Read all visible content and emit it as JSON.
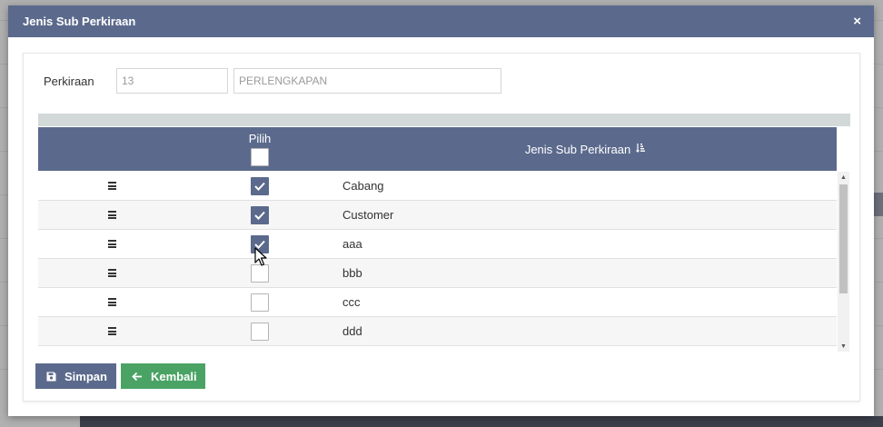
{
  "modal": {
    "title": "Jenis Sub Perkiraan",
    "close_glyph": "×"
  },
  "form": {
    "label": "Perkiraan",
    "code_placeholder": "13",
    "name_placeholder": "PERLENGKAPAN"
  },
  "grid": {
    "headers": {
      "pilih": "Pilih",
      "jenis": "Jenis Sub Perkiraan"
    },
    "header_checkbox_checked": false,
    "rows": [
      {
        "label": "Cabang",
        "checked": true
      },
      {
        "label": "Customer",
        "checked": true
      },
      {
        "label": "aaa",
        "checked": true
      },
      {
        "label": "bbb",
        "checked": false
      },
      {
        "label": "ccc",
        "checked": false
      },
      {
        "label": "ddd",
        "checked": false
      }
    ]
  },
  "buttons": {
    "save_label": "Simpan",
    "back_label": "Kembali"
  },
  "icons": {
    "header_sort": "sort-amount-icon",
    "row_drag": "drag-handle-icon",
    "save": "save-icon",
    "back": "arrow-left-icon"
  },
  "colors": {
    "header_bg": "#5b6a8c",
    "save_bg": "#5b6a8c",
    "back_bg": "#4aa365",
    "grid_bar": "#d3d9d9"
  }
}
